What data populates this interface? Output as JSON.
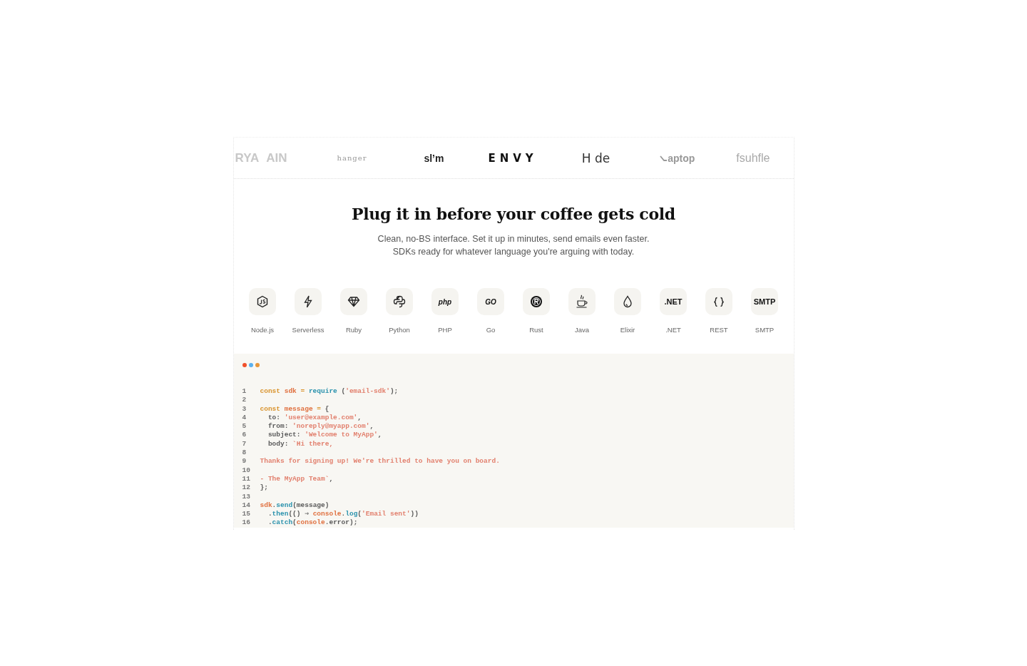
{
  "logos": [
    {
      "text": "RYA"
    },
    {
      "text": "AIN"
    },
    {
      "text": "hanger"
    },
    {
      "text": "sl’m"
    },
    {
      "text": "ENVY"
    },
    {
      "text": "H de"
    },
    {
      "text": "aptop"
    },
    {
      "text": "fsuhfle"
    }
  ],
  "hero": {
    "title": "Plug it in before your coffee gets cold",
    "subtitle": "Clean, no-BS interface. Set it up in minutes, send emails even faster. SDKs ready for whatever language you're arguing with today."
  },
  "sdks": [
    {
      "label": "Node.js",
      "kind": "icon"
    },
    {
      "label": "Serverless",
      "kind": "icon"
    },
    {
      "label": "Ruby",
      "kind": "icon"
    },
    {
      "label": "Python",
      "kind": "icon"
    },
    {
      "label": "PHP",
      "kind": "text",
      "glyph": "php",
      "italic": true
    },
    {
      "label": "Go",
      "kind": "text",
      "glyph": "GO",
      "italic": true
    },
    {
      "label": "Rust",
      "kind": "icon"
    },
    {
      "label": "Java",
      "kind": "icon"
    },
    {
      "label": "Elixir",
      "kind": "icon"
    },
    {
      "label": ".NET",
      "kind": "text",
      "glyph": ".NET",
      "italic": false
    },
    {
      "label": "REST",
      "kind": "icon"
    },
    {
      "label": "SMTP",
      "kind": "text",
      "glyph": "SMTP",
      "italic": false
    }
  ],
  "code": {
    "dots": [
      {
        "color": "#f0502b"
      },
      {
        "color": "#5bb1ee"
      },
      {
        "color": "#e8973a"
      }
    ],
    "lines": [
      {
        "n": "1",
        "tokens": [
          {
            "t": "const",
            "color": "#d9932c"
          },
          {
            "t": "sdk",
            "color": "#e0703f"
          },
          {
            "t": "=",
            "color": "#d9932c"
          },
          {
            "t": "require",
            "color": "#2a92ad"
          },
          {
            "t": "("
          },
          {
            "t": "'email-sdk'",
            "color": "#e2806e"
          },
          {
            "t": ");",
            "color": "#5a5a5a"
          }
        ]
      },
      {
        "n": "2"
      },
      {
        "n": "3",
        "tokens": [
          {
            "t": "const",
            "color": "#d9932c"
          },
          {
            "t": "message",
            "color": "#e0703f"
          },
          {
            "t": "=",
            "color": "#d9932c"
          },
          {
            "t": "{",
            "color": "#5a5a5a"
          }
        ]
      },
      {
        "n": "4",
        "tokens": [
          {
            "t": "to:",
            "color": "#5a5a5a"
          },
          {
            "t": "'user@example.com'",
            "color": "#e2806e"
          },
          {
            "t": ","
          }
        ]
      },
      {
        "n": "5",
        "tokens": [
          {
            "t": "from:",
            "color": "#5a5a5a"
          },
          {
            "t": "'noreply@myapp.com'",
            "color": "#e2806e"
          },
          {
            "t": ","
          }
        ]
      },
      {
        "n": "6",
        "tokens": [
          {
            "t": "subject:",
            "color": "#5a5a5a"
          },
          {
            "t": "'Welcome to MyApp'",
            "color": "#e2806e"
          },
          {
            "t": ","
          }
        ]
      },
      {
        "n": "7",
        "tokens": [
          {
            "t": "body:",
            "color": "#5a5a5a"
          },
          {
            "t": "`Hi there,",
            "color": "#e2806e"
          }
        ]
      },
      {
        "n": "8"
      },
      {
        "n": "9",
        "tokens": [
          {
            "t": "Thanks for signing up! We're thrilled to have you on board.",
            "color": "#e2806e"
          }
        ]
      },
      {
        "n": "10"
      },
      {
        "n": "11",
        "tokens": [
          {
            "t": "- The MyApp Team`",
            "color": "#e2806e"
          },
          {
            "t": ","
          }
        ]
      },
      {
        "n": "12",
        "tokens": [
          {
            "t": "};",
            "color": "#5a5a5a"
          }
        ]
      },
      {
        "n": "13"
      },
      {
        "n": "14",
        "tokens": [
          {
            "t": "sdk",
            "color": "#e0703f"
          },
          {
            "t": "."
          },
          {
            "t": "send",
            "color": "#2a92ad"
          },
          {
            "t": "(message)",
            "color": "#5a5a5a"
          }
        ]
      },
      {
        "n": "15",
        "tokens": [
          {
            "t": "."
          },
          {
            "t": "then",
            "color": "#2a92ad"
          },
          {
            "t": "(()",
            "color": "#5a5a5a"
          },
          {
            "t": "⇒"
          },
          {
            "t": "console",
            "color": "#e0703f"
          },
          {
            "t": "."
          },
          {
            "t": "log",
            "color": "#2a92ad"
          },
          {
            "t": "(",
            "color": "#5a5a5a"
          },
          {
            "t": "'Email sent'",
            "color": "#e2806e"
          },
          {
            "t": "))",
            "color": "#5a5a5a"
          }
        ]
      },
      {
        "n": "16",
        "tokens": [
          {
            "t": "."
          },
          {
            "t": "catch",
            "color": "#2a92ad"
          },
          {
            "t": "(",
            "color": "#5a5a5a"
          },
          {
            "t": "console",
            "color": "#e0703f"
          },
          {
            "t": ".error);",
            "color": "#5a5a5a"
          }
        ]
      }
    ]
  }
}
